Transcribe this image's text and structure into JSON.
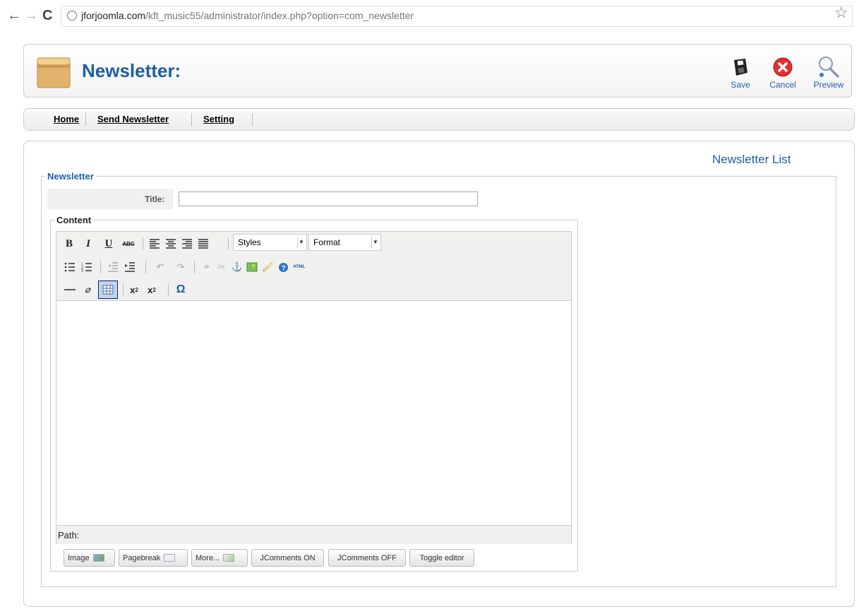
{
  "browser": {
    "url_host": "jforjoomla.com",
    "url_path": "/kft_music55/administrator/index.php?option=com_newsletter"
  },
  "header": {
    "title": "Newsletter:",
    "toolbar": {
      "save": "Save",
      "cancel": "Cancel",
      "preview": "Preview"
    }
  },
  "submenu": {
    "items": [
      "Home",
      "Send Newsletter",
      "Setting"
    ]
  },
  "main": {
    "list_link": "Newsletter List",
    "fieldset_legend": "Newsletter",
    "title_label": "Title:",
    "title_value": "",
    "content_legend": "Content",
    "editor": {
      "styles_select": "Styles",
      "format_select": "Format",
      "path_label": "Path:",
      "buttons": [
        "Image",
        "Pagebreak",
        "More...",
        "JComments ON",
        "JComments OFF",
        "Toggle editor"
      ]
    }
  },
  "colors": {
    "brand_blue": "#1e5ea8",
    "toolbar_bg": "#f0f0ee"
  }
}
